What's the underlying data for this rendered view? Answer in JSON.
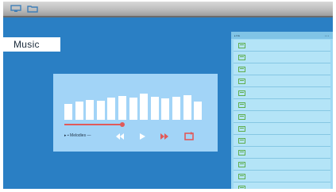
{
  "screen": {
    "title": "Music"
  },
  "top_bar": {
    "left_icon": "monitor-icon",
    "right_icon": "folder-icon"
  },
  "player": {
    "track_name": "▸ ▪ Melodies —",
    "progress": 0.59,
    "equalizer_levels": [
      0.56,
      0.64,
      0.7,
      0.68,
      0.78,
      0.82,
      0.78,
      0.93,
      0.8,
      0.75,
      0.8,
      0.87,
      0.64
    ],
    "controls": [
      {
        "name": "previous-icon"
      },
      {
        "name": "play-icon"
      },
      {
        "name": "fast-forward-icon"
      },
      {
        "name": "repeat-icon"
      }
    ],
    "colors": {
      "panel": "#a2d4f7",
      "accent": "#e05a5a"
    }
  },
  "playlist": {
    "header_left": "▸ File",
    "header_right": "• • •",
    "item_count": 13,
    "item_icon": "file-icon"
  },
  "colors": {
    "background": "#2a7fc4",
    "playlist": "#9ed9f4"
  }
}
